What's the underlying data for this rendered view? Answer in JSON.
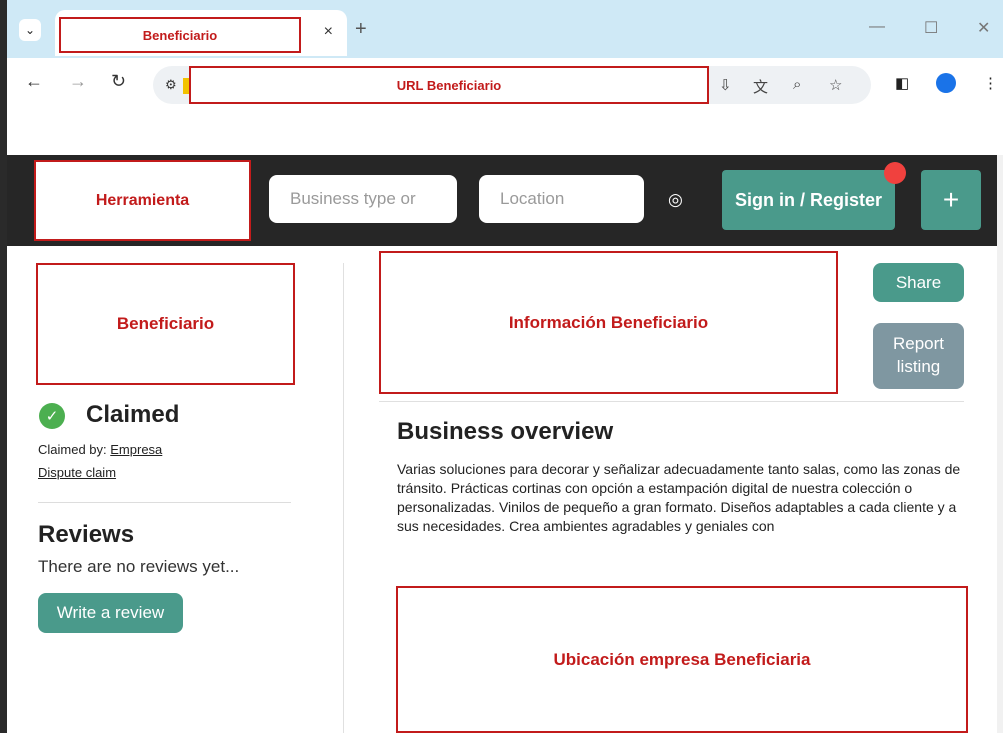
{
  "browser": {
    "tab_title": "Beneficiario",
    "tab_close": "×",
    "new_tab": "+",
    "url": "URL Beneficiario",
    "icons": {
      "tab_search": "chevron-down-icon",
      "back": "back-arrow-icon",
      "forward": "forward-arrow-icon",
      "reload": "reload-icon",
      "site_info": "tune-icon",
      "install": "install-app-icon",
      "translate": "translate-icon",
      "zoom": "zoom-icon",
      "bookmark": "star-icon",
      "side_panel": "side-panel-icon",
      "profile": "profile-icon",
      "menu": "more-vert-icon"
    },
    "colors": {
      "tab_strip": "#cfe9f6"
    }
  },
  "header": {
    "tool_placeholder": "Herramienta",
    "business_placeholder": "Business type or",
    "location_placeholder": "Location",
    "sign_in_label": "Sign in / Register",
    "plus_label": "+",
    "colors": {
      "background": "#262626",
      "accent": "#4a9a8b",
      "notification": "#f0413e"
    }
  },
  "left": {
    "beneficiario_placeholder": "Beneficiario",
    "claimed_title": "Claimed",
    "claimed_by_prefix": "Claimed by:",
    "claimed_by_link": "Empresa",
    "dispute_link": "Dispute claim",
    "reviews_title": "Reviews",
    "reviews_empty": "There are no reviews yet...",
    "write_review_label": "Write a review"
  },
  "right": {
    "info_placeholder": "Información Beneficiario",
    "share_label": "Share",
    "report_line1": "Report",
    "report_line2": "listing",
    "overview_title": "Business overview",
    "overview_text": "Varias soluciones para decorar y señalizar adecuadamente tanto salas, como las zonas de tránsito. Prácticas cortinas con opción a estampación digital de nuestra colección o personalizadas. Vinilos de pequeño a gran formato. Diseños adaptables a cada cliente y a sus necesidades. Crea ambientes agradables y geniales con",
    "location_placeholder": "Ubicación empresa Beneficiaria",
    "colors": {
      "report_button": "#7f97a1",
      "placeholder_border": "#c21b1b"
    }
  }
}
